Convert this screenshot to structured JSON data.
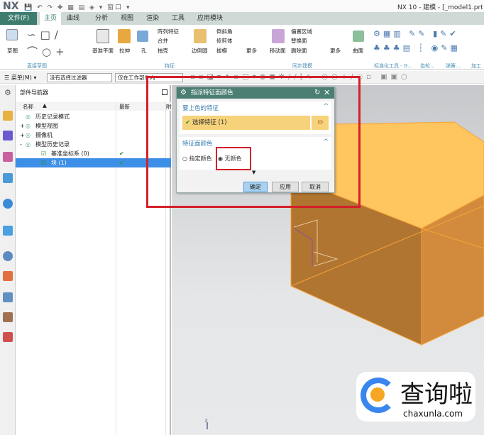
{
  "app": {
    "logo": "NX",
    "window_title": "NX 10 - 建模 - [_model1.prt (",
    "quick_access": "窗口"
  },
  "tabs": {
    "file": "文件(F)",
    "items": [
      "主页",
      "曲线",
      "分析",
      "视图",
      "渲染",
      "工具",
      "应用模块"
    ],
    "active": "主页"
  },
  "ribbon": {
    "groups": [
      "直接草图",
      "特征",
      "同步建模",
      "标准化工具 - G...",
      "齿轮...",
      "弹簧...",
      "加工"
    ],
    "buttons": {
      "sketch": "草图",
      "datum_plane": "基准平面",
      "extrude": "拉伸",
      "hole": "孔",
      "pattern": "阵列特征",
      "unite": "合并",
      "shell": "抽壳",
      "edge_blend": "边倒圆",
      "chamfer": "倒斜角",
      "trim_body": "修剪体",
      "draft": "拔模",
      "more1": "更多",
      "move_face": "移动面",
      "offset_region": "偏置区域",
      "replace_face": "替换面",
      "delete_face": "删除面",
      "more2": "更多",
      "surface": "曲面"
    }
  },
  "toolbar": {
    "menu": "菜单(M)",
    "filter": "没有选择过滤器",
    "scope": "仅在工作部件内"
  },
  "navigator": {
    "title": "部件导航器",
    "columns": [
      "名称",
      "最新",
      "附"
    ],
    "rows": [
      {
        "label": "历史记录模式",
        "expander": "",
        "latest": false,
        "selected": false,
        "indent": 0
      },
      {
        "label": "模型视图",
        "expander": "+",
        "latest": false,
        "selected": false,
        "indent": 0
      },
      {
        "label": "摄像机",
        "expander": "+",
        "latest": false,
        "selected": false,
        "indent": 0
      },
      {
        "label": "模型历史记录",
        "expander": "-",
        "latest": false,
        "selected": false,
        "indent": 0
      },
      {
        "label": "基准坐标系 (0)",
        "expander": "",
        "latest": true,
        "selected": false,
        "indent": 1
      },
      {
        "label": "块 (1)",
        "expander": "",
        "latest": true,
        "selected": true,
        "indent": 1
      }
    ]
  },
  "dialog": {
    "title": "指派特征面颜色",
    "section1": "要上色的特征",
    "select_feature": "选择特征 (1)",
    "section2": "特征面颜色",
    "radio_specify": "指定颜色",
    "radio_none": "无颜色",
    "selected_radio": "无颜色",
    "ok": "确定",
    "apply": "应用",
    "cancel": "取消"
  },
  "colors": {
    "accent": "#4c7f74",
    "highlight": "#f6d27a",
    "body": "#f0a33f",
    "annotation": "#d4202a",
    "selection": "#3d8ee6"
  },
  "watermark": {
    "name": "查询啦",
    "url": "chaxunla.com"
  }
}
